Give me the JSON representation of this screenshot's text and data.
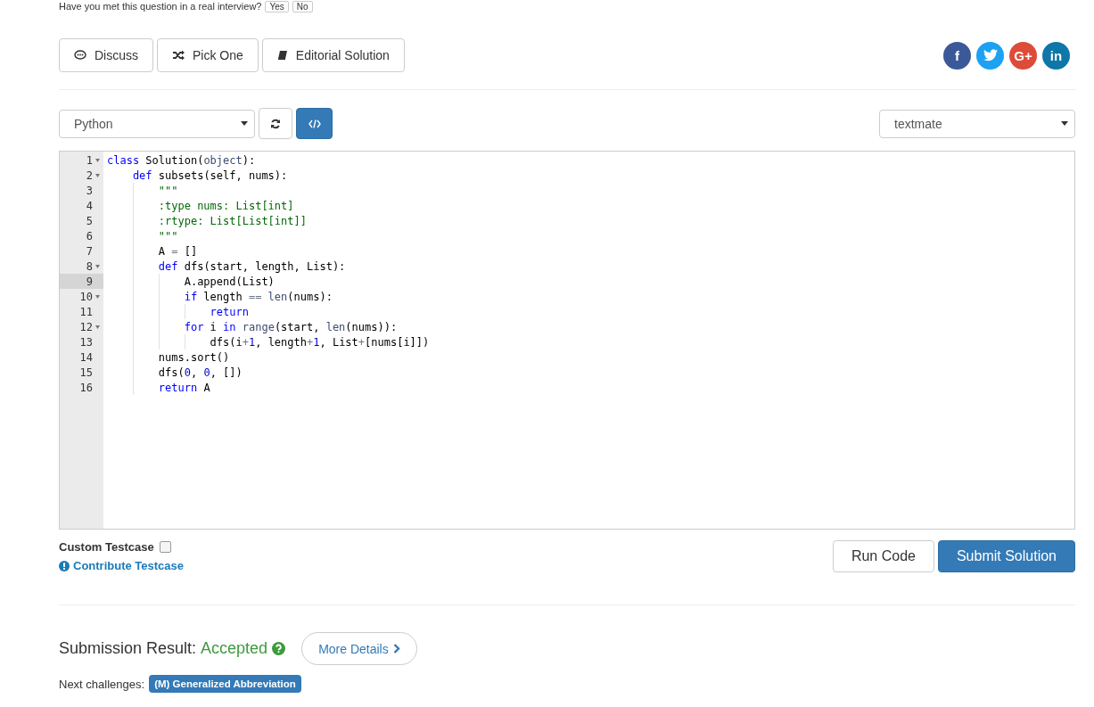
{
  "interview": {
    "question": "Have you met this question in a real interview?",
    "answers": [
      "Yes",
      "No"
    ]
  },
  "actions": [
    {
      "kind": "discuss",
      "label": "Discuss"
    },
    {
      "kind": "pick",
      "label": "Pick One"
    },
    {
      "kind": "editorial",
      "label": "Editorial Solution"
    }
  ],
  "social": [
    {
      "kind": "facebook",
      "glyph": "f",
      "color": "#3b5998"
    },
    {
      "kind": "twitter",
      "color": "#1da1f2"
    },
    {
      "kind": "google",
      "glyph": "G+",
      "color": "#dd4b39"
    },
    {
      "kind": "linkedin",
      "glyph": "in",
      "color": "#0e76a8"
    }
  ],
  "language": {
    "value": "Python"
  },
  "theme": {
    "value": "textmate"
  },
  "code_toggle": {
    "on": true
  },
  "editor": {
    "lines": [
      {
        "number": "1",
        "foldable": true,
        "selected": false,
        "tokens": [
          {
            "kind": "kw",
            "text": "class"
          },
          {
            "kind": "plain",
            "text": " Solution("
          },
          {
            "kind": "builtin",
            "text": "object"
          },
          {
            "kind": "plain",
            "text": "):"
          }
        ]
      },
      {
        "number": "2",
        "foldable": true,
        "selected": false,
        "tokens": [
          {
            "kind": "kw",
            "text": "    def"
          },
          {
            "kind": "plain",
            "text": " subsets(self, nums):"
          }
        ]
      },
      {
        "number": "3",
        "foldable": false,
        "selected": false,
        "tokens": [
          {
            "kind": "str",
            "text": "        \"\"\""
          }
        ]
      },
      {
        "number": "4",
        "foldable": false,
        "selected": false,
        "tokens": [
          {
            "kind": "str",
            "text": "        :type nums: List[int]"
          }
        ]
      },
      {
        "number": "5",
        "foldable": false,
        "selected": false,
        "tokens": [
          {
            "kind": "str",
            "text": "        :rtype: List[List[int]]"
          }
        ]
      },
      {
        "number": "6",
        "foldable": false,
        "selected": false,
        "tokens": [
          {
            "kind": "str",
            "text": "        \"\"\""
          }
        ]
      },
      {
        "number": "7",
        "foldable": false,
        "selected": false,
        "tokens": [
          {
            "kind": "plain",
            "text": "        A "
          },
          {
            "kind": "op",
            "text": "="
          },
          {
            "kind": "plain",
            "text": " []"
          }
        ]
      },
      {
        "number": "8",
        "foldable": true,
        "selected": false,
        "tokens": [
          {
            "kind": "kw",
            "text": "        def"
          },
          {
            "kind": "plain",
            "text": " dfs(start, length, List):"
          }
        ]
      },
      {
        "number": "9",
        "foldable": false,
        "selected": true,
        "tokens": [
          {
            "kind": "plain",
            "text": "            A.append(List)"
          }
        ]
      },
      {
        "number": "10",
        "foldable": true,
        "selected": false,
        "tokens": [
          {
            "kind": "kw",
            "text": "            if"
          },
          {
            "kind": "plain",
            "text": " length "
          },
          {
            "kind": "op",
            "text": "=="
          },
          {
            "kind": "builtin",
            "text": " len"
          },
          {
            "kind": "plain",
            "text": "(nums):"
          }
        ]
      },
      {
        "number": "11",
        "foldable": false,
        "selected": false,
        "tokens": [
          {
            "kind": "kw",
            "text": "                return"
          }
        ]
      },
      {
        "number": "12",
        "foldable": true,
        "selected": false,
        "tokens": [
          {
            "kind": "kw",
            "text": "            for"
          },
          {
            "kind": "plain",
            "text": " i "
          },
          {
            "kind": "kw",
            "text": "in"
          },
          {
            "kind": "builtin",
            "text": " range"
          },
          {
            "kind": "plain",
            "text": "(start, "
          },
          {
            "kind": "builtin",
            "text": "len"
          },
          {
            "kind": "plain",
            "text": "(nums)):"
          }
        ]
      },
      {
        "number": "13",
        "foldable": false,
        "selected": false,
        "tokens": [
          {
            "kind": "plain",
            "text": "                dfs(i"
          },
          {
            "kind": "op",
            "text": "+"
          },
          {
            "kind": "num",
            "text": "1"
          },
          {
            "kind": "plain",
            "text": ", length"
          },
          {
            "kind": "op",
            "text": "+"
          },
          {
            "kind": "num",
            "text": "1"
          },
          {
            "kind": "plain",
            "text": ", List"
          },
          {
            "kind": "op",
            "text": "+"
          },
          {
            "kind": "plain",
            "text": "[nums[i]])"
          }
        ]
      },
      {
        "number": "14",
        "foldable": false,
        "selected": false,
        "tokens": [
          {
            "kind": "plain",
            "text": "        nums.sort()"
          }
        ]
      },
      {
        "number": "15",
        "foldable": false,
        "selected": false,
        "tokens": [
          {
            "kind": "plain",
            "text": "        dfs("
          },
          {
            "kind": "num",
            "text": "0"
          },
          {
            "kind": "plain",
            "text": ", "
          },
          {
            "kind": "num",
            "text": "0"
          },
          {
            "kind": "plain",
            "text": ", [])"
          }
        ]
      },
      {
        "number": "16",
        "foldable": false,
        "selected": false,
        "tokens": [
          {
            "kind": "kw",
            "text": "        return"
          },
          {
            "kind": "plain",
            "text": " A"
          }
        ]
      }
    ]
  },
  "custom_testcase": {
    "label": "Custom Testcase",
    "checked": false
  },
  "contribute": {
    "label": "Contribute Testcase"
  },
  "run_button": {
    "label": "Run Code"
  },
  "submit_button": {
    "label": "Submit Solution"
  },
  "result": {
    "label": "Submission Result:",
    "status": "Accepted",
    "details": "More Details"
  },
  "next": {
    "label": "Next challenges:",
    "challenges": [
      "(M) Generalized Abbreviation"
    ]
  }
}
